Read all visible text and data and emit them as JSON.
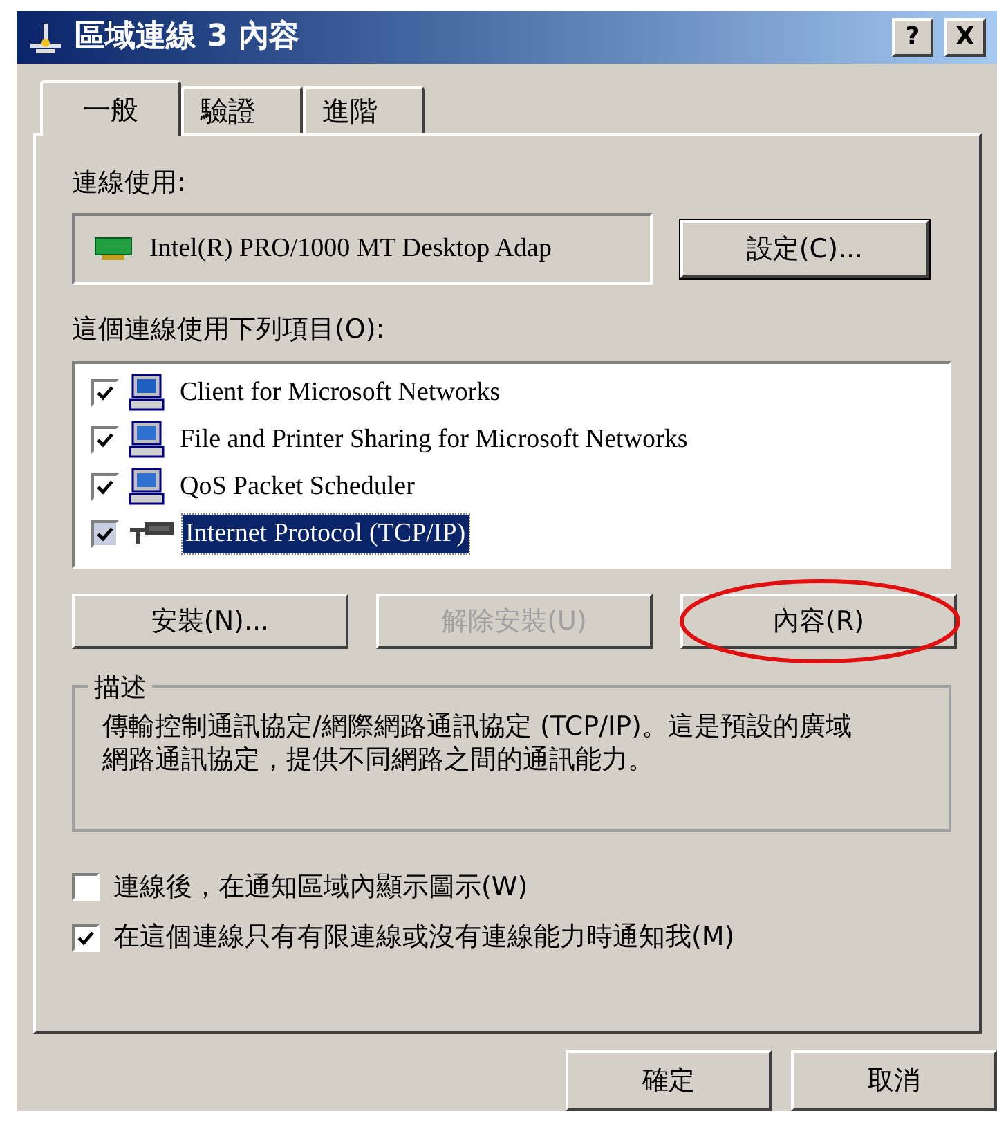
{
  "window": {
    "title": "區域連線 3 內容",
    "title_buttons": [
      "?",
      "X"
    ]
  },
  "tabs": [
    {
      "label": "一般",
      "selected": true
    },
    {
      "label": "驗證",
      "selected": false
    },
    {
      "label": "進階",
      "selected": false
    }
  ],
  "connect_using": {
    "label": "連線使用:",
    "adapter": "Intel(R) PRO/1000 MT Desktop Adap",
    "configure_button": "設定(C)..."
  },
  "items_label": "這個連線使用下列項目(O):",
  "items": [
    {
      "label": "Client for Microsoft Networks",
      "checked": true,
      "selected": false,
      "kind": "client"
    },
    {
      "label": "File and Printer Sharing for Microsoft Networks",
      "checked": true,
      "selected": false,
      "kind": "service"
    },
    {
      "label": "QoS Packet Scheduler",
      "checked": true,
      "selected": false,
      "kind": "service"
    },
    {
      "label": "Internet Protocol (TCP/IP)",
      "checked": true,
      "selected": true,
      "kind": "protocol"
    }
  ],
  "item_buttons": [
    {
      "label": "安裝(N)...",
      "disabled": false,
      "highlighted": false
    },
    {
      "label": "解除安裝(U)",
      "disabled": true,
      "highlighted": false
    },
    {
      "label": "內容(R)",
      "disabled": false,
      "highlighted": true
    }
  ],
  "description": {
    "title": "描述",
    "text": "傳輸控制通訊協定/網際網路通訊協定 (TCP/IP)。這是預設的廣域網路通訊協定，提供不同網路之間的通訊能力。"
  },
  "options": [
    {
      "label": "連線後，在通知區域內顯示圖示(W)",
      "checked": false
    },
    {
      "label": "在這個連線只有有限連線或沒有連線能力時通知我(M)",
      "checked": true
    }
  ],
  "footer_buttons": [
    "確定",
    "取消"
  ]
}
